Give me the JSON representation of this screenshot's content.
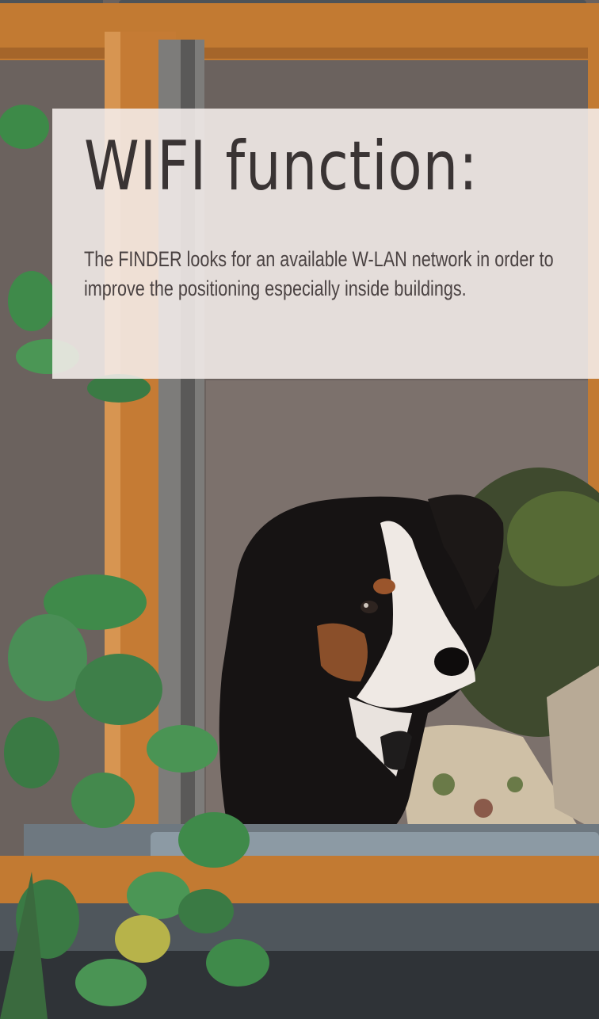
{
  "headline": "WIFI function:",
  "description": "The FINDER looks for an available W-LAN network in order to improve the positioning especially inside buildings.",
  "colors": {
    "panel": "#f5eeec",
    "text": "#3a3434",
    "window_frame": "#c97a2f",
    "dog_black": "#141212",
    "dog_white": "#f1ede9",
    "dog_tan": "#8a4f2a",
    "leaf": "#3f8a4a"
  }
}
